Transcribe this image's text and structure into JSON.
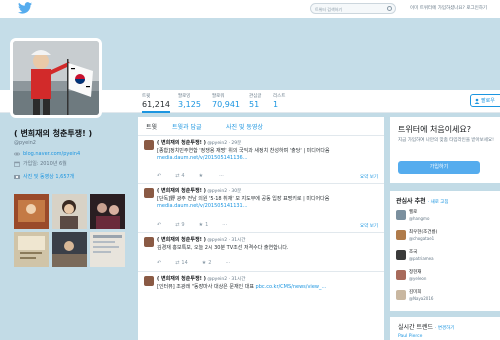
{
  "topbar": {
    "search_placeholder": "트위터 검색하기",
    "login_prompt": "이미 트위터에 가입하셨나요? 로그인하기"
  },
  "profile": {
    "name": "( 변희재의 청춘투쟁! )",
    "handle": "@pyein2",
    "website": "blog.naver.com/pyein4",
    "joined": "가입일: 2010년 6월",
    "photos_label": "사진 및 동영상 1,657개"
  },
  "stats": [
    {
      "label": "트윗",
      "value": "61,214",
      "active": true
    },
    {
      "label": "팔로잉",
      "value": "3,125",
      "active": false
    },
    {
      "label": "팔로워",
      "value": "70,941",
      "active": false
    },
    {
      "label": "관심글",
      "value": "51",
      "active": false
    },
    {
      "label": "리스트",
      "value": "1",
      "active": false
    }
  ],
  "follow_button": "팔로우",
  "timeline": {
    "tabs": [
      "트윗",
      "트윗과 답글",
      "사진 및 동영상"
    ],
    "tweets": [
      {
        "author": "( 변희재의 청춘투쟁! )",
        "handle": "@pyein2",
        "time": "29분",
        "text": "[종합]정치민주연합 '정쟁용 재명' 위의 국익과 새정치 찬성하며 '출당' | 미디어다음",
        "link": "media.daum.net/v/201505141136...",
        "retweets": "4",
        "likes": "",
        "summary_label": "요약 보기"
      },
      {
        "author": "( 변희재의 청춘투쟁! )",
        "handle": "@pyein2",
        "time": "30분",
        "text": "[단독]野 광주 전남 의원 '5·18 취재' 모 지도부에 공동 입장 표명키로 | 미디어다음",
        "link": "media.daum.net/v/201505141131...",
        "retweets": "9",
        "likes": "1",
        "summary_label": "요약 보기"
      },
      {
        "author": "( 변희재의 청춘투쟁! )",
        "handle": "@pyein2",
        "time": "31시간",
        "text": "김경재 홍보특보, 오늘 2시 30분 TV조선 저격수다 출연합니다.",
        "link": "",
        "retweets": "14",
        "likes": "2",
        "summary_label": ""
      },
      {
        "author": "( 변희재의 청춘투쟁! )",
        "handle": "@pyein2",
        "time": "31시간",
        "text": "[인터뷰] 조광래 \"동장마사 대상은 문재인 대표",
        "link": "pbc.co.kr/CMS/news/view_...",
        "retweets": "",
        "likes": "",
        "summary_label": ""
      }
    ]
  },
  "signup": {
    "title": "트위터에 처음이세요?",
    "desc": "지금 가입하여 나만의 맞춤 타임라인을 받아보세요!",
    "button": "가입하기"
  },
  "who_to_follow": {
    "title": "관심사 추천",
    "refresh": "· 새로 고침",
    "items": [
      {
        "name": "헬로",
        "handle": "@hangmo",
        "color": "#7a8f9e"
      },
      {
        "name": "최우현(조건룡)",
        "handle": "@chogatae1",
        "color": "#b07b4a"
      },
      {
        "name": "조국",
        "handle": "@patriamea",
        "color": "#3a3a3a"
      },
      {
        "name": "정현재",
        "handle": "@yeleon",
        "color": "#a86a5a"
      },
      {
        "name": "김미희",
        "handle": "@Naya2016",
        "color": "#c9b7a0"
      }
    ]
  },
  "trends": {
    "title": "실시간 트렌드",
    "change": "· 변경하기",
    "first": "Paul Pierce"
  },
  "colors": {
    "accent": "#1b95e0",
    "banner": "#c5dde8"
  }
}
